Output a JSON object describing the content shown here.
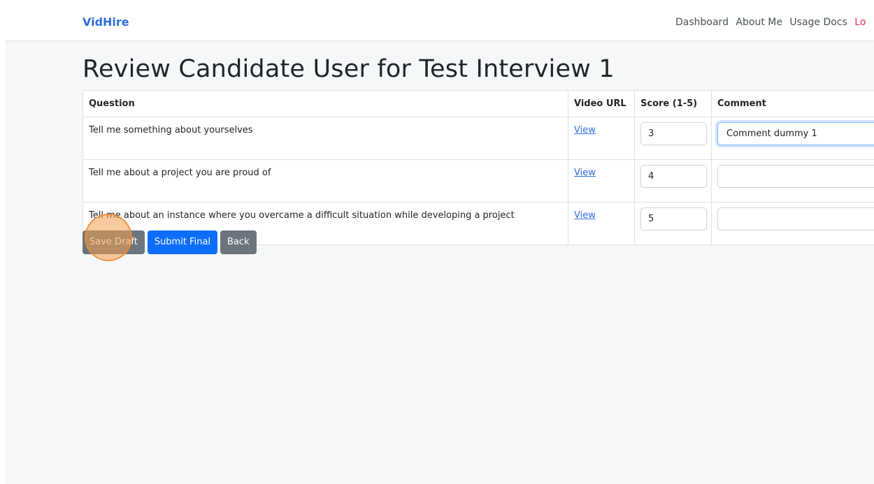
{
  "navbar": {
    "brand": "VidHire",
    "links": [
      "Dashboard",
      "About Me",
      "Usage Docs"
    ],
    "logout": "Lo"
  },
  "page": {
    "title": "Review Candidate User for Test Interview 1"
  },
  "table": {
    "headers": [
      "Question",
      "Video URL",
      "Score (1-5)",
      "Comment"
    ],
    "rows": [
      {
        "question": "Tell me something about yourselves",
        "video_link": "View",
        "score": "3",
        "comment": "Comment dummy 1"
      },
      {
        "question": "Tell me about a project you are proud of",
        "video_link": "View",
        "score": "4",
        "comment": ""
      },
      {
        "question": "Tell me about an instance where you overcame a difficult situation while developing a project",
        "video_link": "View",
        "score": "5",
        "comment": ""
      }
    ]
  },
  "actions": {
    "save_draft": "Save Draft",
    "submit_final": "Submit Final",
    "back": "Back"
  },
  "colors": {
    "brand": "#2d6cdf",
    "primary": "#0d6efd",
    "secondary": "#6c757d",
    "logout": "#dc3545",
    "click_marker": "#f49e4e"
  }
}
